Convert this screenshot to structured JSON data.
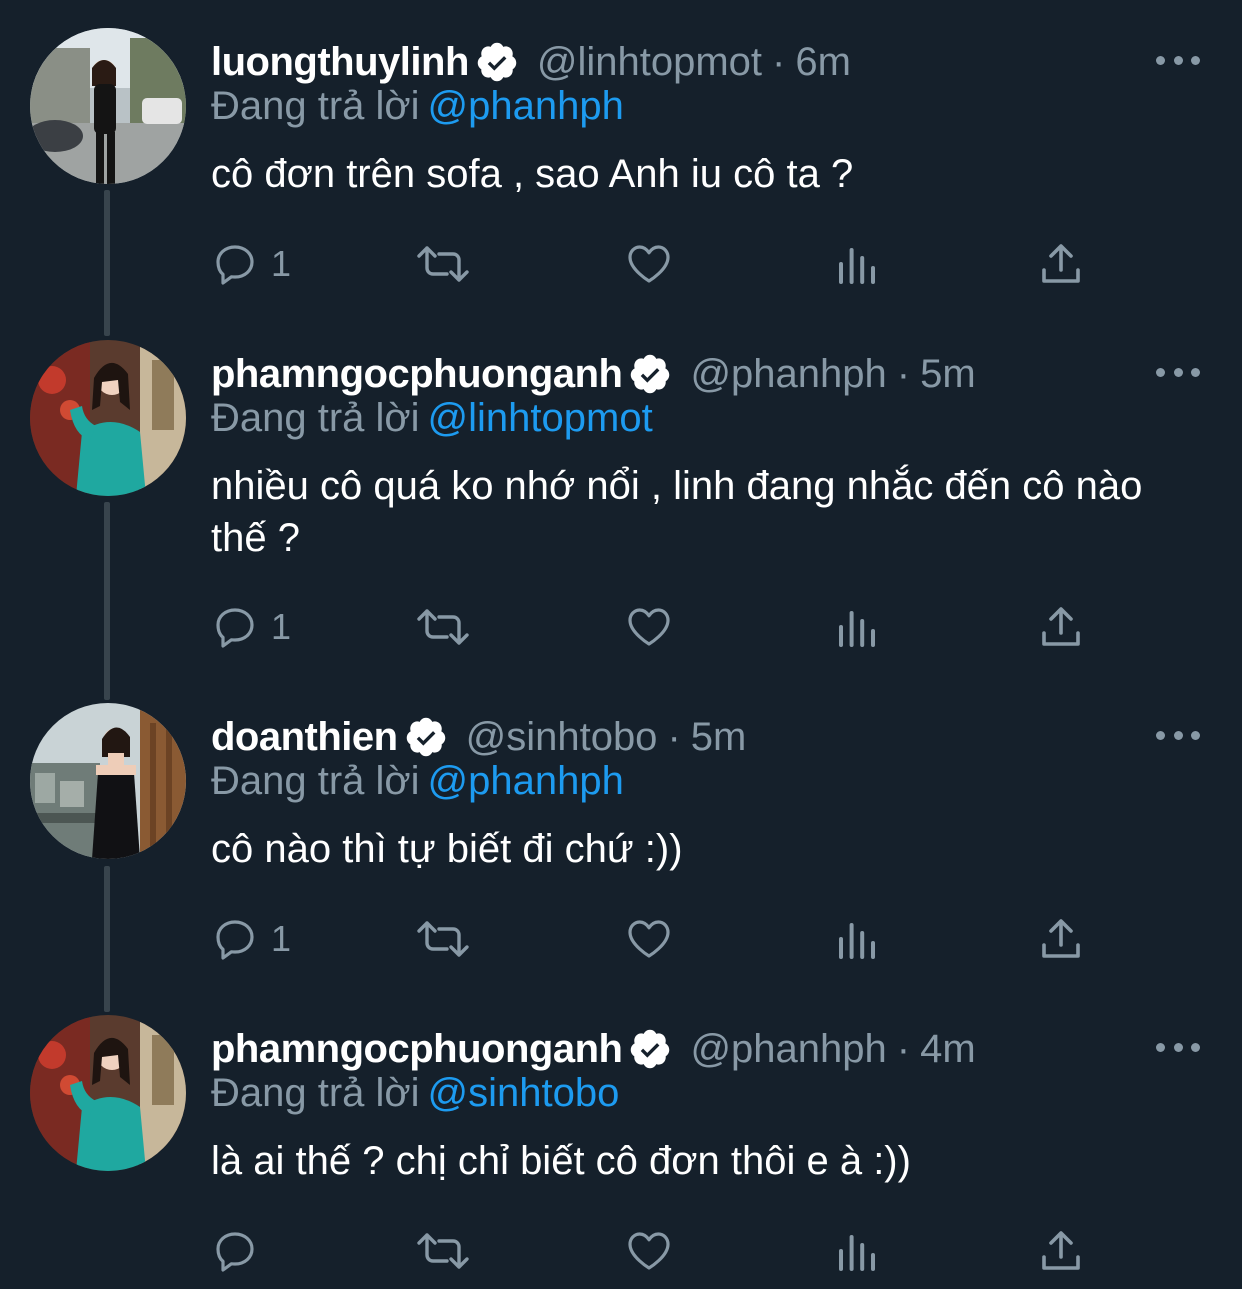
{
  "tweets": [
    {
      "name": "luongthuylinh",
      "handle": "@linhtopmot",
      "time": "6m",
      "replying_label": "Đang trả lời",
      "replying_to": "@phanhph",
      "text": "cô đơn trên sofa , sao Anh iu cô ta ?",
      "reply_count": "1",
      "avatar": "woman-black-outfit-street"
    },
    {
      "name": "phamngocphuonganh",
      "handle": "@phanhph",
      "time": "5m",
      "replying_label": "Đang trả lời",
      "replying_to": "@linhtopmot",
      "text": "nhiều cô quá ko nhớ nổi , linh đang nhắc đến cô nào thế ?",
      "reply_count": "1",
      "avatar": "woman-teal-dress"
    },
    {
      "name": "doanthien",
      "handle": "@sinhtobo",
      "time": "5m",
      "replying_label": "Đang trả lời",
      "replying_to": "@phanhph",
      "text": "cô nào thì tự biết đi chứ :))",
      "reply_count": "1",
      "avatar": "woman-black-dress-balcony"
    },
    {
      "name": "phamngocphuonganh",
      "handle": "@phanhph",
      "time": "4m",
      "replying_label": "Đang trả lời",
      "replying_to": "@sinhtobo",
      "text": "là ai thế ? chị chỉ biết cô đơn thôi e à :))",
      "reply_count": "",
      "avatar": "woman-teal-dress"
    }
  ],
  "separator": "·",
  "colors": {
    "background": "#15202b",
    "secondary_text": "#8899a6",
    "link": "#1d9bf0",
    "thread_line": "#38444d"
  },
  "icons": [
    "verified-icon",
    "more-icon",
    "reply-icon",
    "retweet-icon",
    "like-icon",
    "analytics-icon",
    "share-icon"
  ]
}
